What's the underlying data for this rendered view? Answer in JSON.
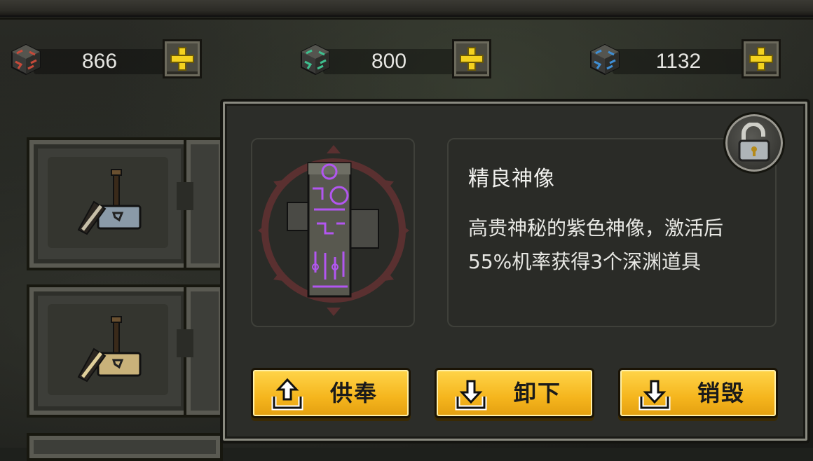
{
  "resources": [
    {
      "value": "866",
      "icon": "red-rune-cube-icon",
      "accent": "#c64a3a"
    },
    {
      "value": "800",
      "icon": "green-rune-cube-icon",
      "accent": "#3fbf8f"
    },
    {
      "value": "1132",
      "icon": "blue-rune-cube-icon",
      "accent": "#3f8ed4"
    }
  ],
  "slots": [
    {
      "icon": "hammer-icon",
      "tint": "#8a9aa8"
    },
    {
      "icon": "hammer-icon",
      "tint": "#c9b27a"
    }
  ],
  "item": {
    "name": "精良神像",
    "description": "高贵神秘的紫色神像，激活后55%机率获得3个深渊道具",
    "rarity_color": "#b256f0",
    "icon": "purple-totem-statue-icon",
    "locked": false
  },
  "actions": [
    {
      "label": "供奉",
      "icon": "upload-tray-icon"
    },
    {
      "label": "卸下",
      "icon": "download-tray-icon"
    },
    {
      "label": "销毁",
      "icon": "download-tray-icon"
    }
  ]
}
